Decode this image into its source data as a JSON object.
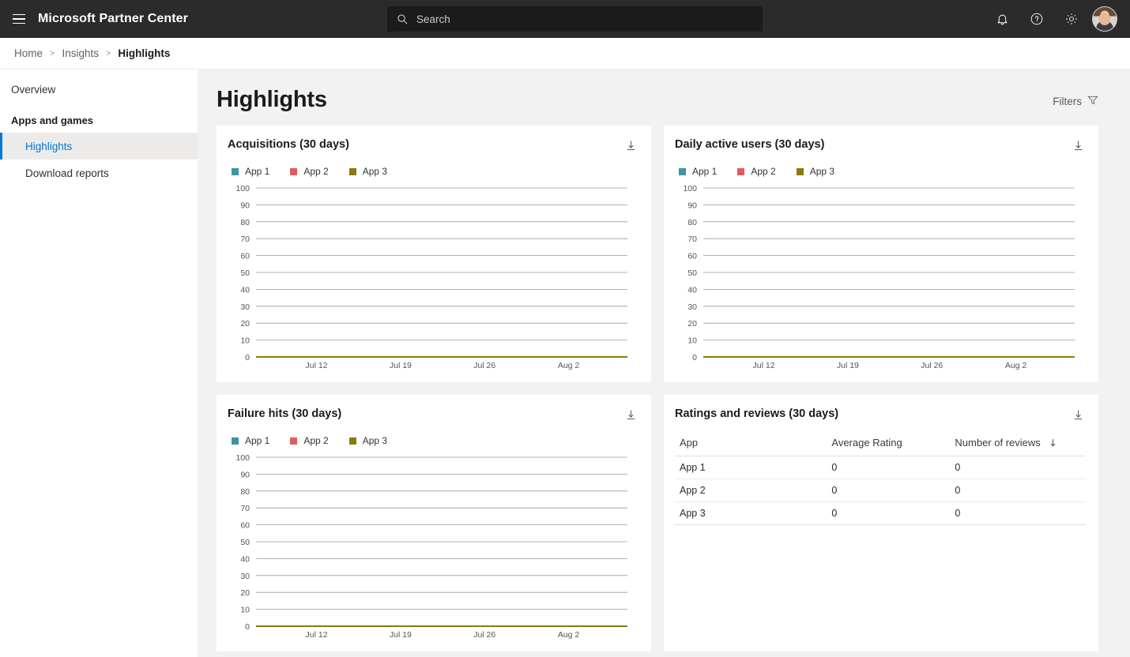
{
  "topbar": {
    "menu_icon": "hamburger-icon",
    "brand": "Microsoft Partner Center",
    "search": {
      "placeholder": "Search",
      "value": "",
      "icon": "search-icon"
    },
    "actions": [
      {
        "name": "notifications",
        "icon": "bell-icon"
      },
      {
        "name": "help",
        "icon": "help-icon"
      },
      {
        "name": "settings",
        "icon": "gear-icon"
      },
      {
        "name": "account",
        "icon": "avatar"
      }
    ]
  },
  "breadcrumb": {
    "home": "Home",
    "insights": "Insights",
    "current": "Highlights",
    "separator": ">"
  },
  "sidebar": {
    "overview": "Overview",
    "section": "Apps and games",
    "items": [
      {
        "label": "Highlights",
        "selected": true
      },
      {
        "label": "Download reports",
        "selected": false
      }
    ]
  },
  "page": {
    "title": "Highlights",
    "filters_label": "Filters",
    "filters_icon": "funnel-icon"
  },
  "cards": {
    "acquisitions": {
      "title": "Acquisitions (30 days)",
      "download_icon": "download-icon"
    },
    "daily_active_users": {
      "title": "Daily active users (30 days)",
      "download_icon": "download-icon"
    },
    "failure_hits": {
      "title": "Failure hits (30 days)",
      "download_icon": "download-icon"
    },
    "ratings_reviews": {
      "title": "Ratings and reviews (30 days)",
      "download_icon": "download-icon"
    }
  },
  "ratings_table": {
    "headers": {
      "app": "App",
      "avg": "Average Rating",
      "reviews": "Number of reviews"
    },
    "sort_icon": "sort-descending-arrow",
    "rows": [
      {
        "app": "App 1",
        "avg": "0",
        "reviews": "0"
      },
      {
        "app": "App 2",
        "avg": "0",
        "reviews": "0"
      },
      {
        "app": "App 3",
        "avg": "0",
        "reviews": "0"
      }
    ]
  },
  "colors": {
    "app1": "#3E93A6",
    "app2": "#E05C5C",
    "app3": "#8A7A11",
    "accent": "#0078D4",
    "topbar_bg": "#2B2B2B",
    "page_bg": "#F2F2F2",
    "gridline": "#9a9a9a"
  },
  "chart_data": [
    {
      "id": "acquisitions",
      "type": "line",
      "title": "Acquisitions (30 days)",
      "xlabel": "",
      "ylabel": "",
      "ylim": [
        0,
        100
      ],
      "yticks": [
        0,
        10,
        20,
        30,
        40,
        50,
        60,
        70,
        80,
        90,
        100
      ],
      "xticks": [
        "Jul 12",
        "Jul 19",
        "Jul 26",
        "Aug 2"
      ],
      "grid": true,
      "legend": [
        "App 1",
        "App 2",
        "App 3"
      ],
      "legend_position": "top-left",
      "series": [
        {
          "name": "App 1",
          "color": "#3E93A6",
          "values": [
            0,
            0,
            0,
            0,
            0,
            0,
            0,
            0,
            0,
            0,
            0,
            0,
            0,
            0,
            0,
            0,
            0,
            0,
            0,
            0,
            0,
            0,
            0,
            0,
            0,
            0,
            0,
            0,
            0,
            0
          ]
        },
        {
          "name": "App 2",
          "color": "#E05C5C",
          "values": [
            0,
            0,
            0,
            0,
            0,
            0,
            0,
            0,
            0,
            0,
            0,
            0,
            0,
            0,
            0,
            0,
            0,
            0,
            0,
            0,
            0,
            0,
            0,
            0,
            0,
            0,
            0,
            0,
            0,
            0
          ]
        },
        {
          "name": "App 3",
          "color": "#8A7A11",
          "values": [
            0,
            0,
            0,
            0,
            0,
            0,
            0,
            0,
            0,
            0,
            0,
            0,
            0,
            0,
            0,
            0,
            0,
            0,
            0,
            0,
            0,
            0,
            0,
            0,
            0,
            0,
            0,
            0,
            0,
            0
          ]
        }
      ]
    },
    {
      "id": "daily_active_users",
      "type": "line",
      "title": "Daily active users (30 days)",
      "xlabel": "",
      "ylabel": "",
      "ylim": [
        0,
        100
      ],
      "yticks": [
        0,
        10,
        20,
        30,
        40,
        50,
        60,
        70,
        80,
        90,
        100
      ],
      "xticks": [
        "Jul 12",
        "Jul 19",
        "Jul 26",
        "Aug 2"
      ],
      "grid": true,
      "legend": [
        "App 1",
        "App 2",
        "App 3"
      ],
      "legend_position": "top-left",
      "series": [
        {
          "name": "App 1",
          "color": "#3E93A6",
          "values": [
            0,
            0,
            0,
            0,
            0,
            0,
            0,
            0,
            0,
            0,
            0,
            0,
            0,
            0,
            0,
            0,
            0,
            0,
            0,
            0,
            0,
            0,
            0,
            0,
            0,
            0,
            0,
            0,
            0,
            0
          ]
        },
        {
          "name": "App 2",
          "color": "#E05C5C",
          "values": [
            0,
            0,
            0,
            0,
            0,
            0,
            0,
            0,
            0,
            0,
            0,
            0,
            0,
            0,
            0,
            0,
            0,
            0,
            0,
            0,
            0,
            0,
            0,
            0,
            0,
            0,
            0,
            0,
            0,
            0
          ]
        },
        {
          "name": "App 3",
          "color": "#8A7A11",
          "values": [
            0,
            0,
            0,
            0,
            0,
            0,
            0,
            0,
            0,
            0,
            0,
            0,
            0,
            0,
            0,
            0,
            0,
            0,
            0,
            0,
            0,
            0,
            0,
            0,
            0,
            0,
            0,
            0,
            0,
            0
          ]
        }
      ]
    },
    {
      "id": "failure_hits",
      "type": "line",
      "title": "Failure hits (30 days)",
      "xlabel": "",
      "ylabel": "",
      "ylim": [
        0,
        100
      ],
      "yticks": [
        0,
        10,
        20,
        30,
        40,
        50,
        60,
        70,
        80,
        90,
        100
      ],
      "xticks": [
        "Jul 12",
        "Jul 19",
        "Jul 26",
        "Aug 2"
      ],
      "grid": true,
      "legend": [
        "App 1",
        "App 2",
        "App 3"
      ],
      "legend_position": "top-left",
      "series": [
        {
          "name": "App 1",
          "color": "#3E93A6",
          "values": [
            0,
            0,
            0,
            0,
            0,
            0,
            0,
            0,
            0,
            0,
            0,
            0,
            0,
            0,
            0,
            0,
            0,
            0,
            0,
            0,
            0,
            0,
            0,
            0,
            0,
            0,
            0,
            0,
            0,
            0
          ]
        },
        {
          "name": "App 2",
          "color": "#E05C5C",
          "values": [
            0,
            0,
            0,
            0,
            0,
            0,
            0,
            0,
            0,
            0,
            0,
            0,
            0,
            0,
            0,
            0,
            0,
            0,
            0,
            0,
            0,
            0,
            0,
            0,
            0,
            0,
            0,
            0,
            0,
            0
          ]
        },
        {
          "name": "App 3",
          "color": "#8A7A11",
          "values": [
            0,
            0,
            0,
            0,
            0,
            0,
            0,
            0,
            0,
            0,
            0,
            0,
            0,
            0,
            0,
            0,
            0,
            0,
            0,
            0,
            0,
            0,
            0,
            0,
            0,
            0,
            0,
            0,
            0,
            0
          ]
        }
      ]
    },
    {
      "id": "ratings_reviews",
      "type": "table",
      "title": "Ratings and reviews (30 days)",
      "columns": [
        "App",
        "Average Rating",
        "Number of reviews"
      ],
      "rows": [
        [
          "App 1",
          0,
          0
        ],
        [
          "App 2",
          0,
          0
        ],
        [
          "App 3",
          0,
          0
        ]
      ]
    }
  ]
}
